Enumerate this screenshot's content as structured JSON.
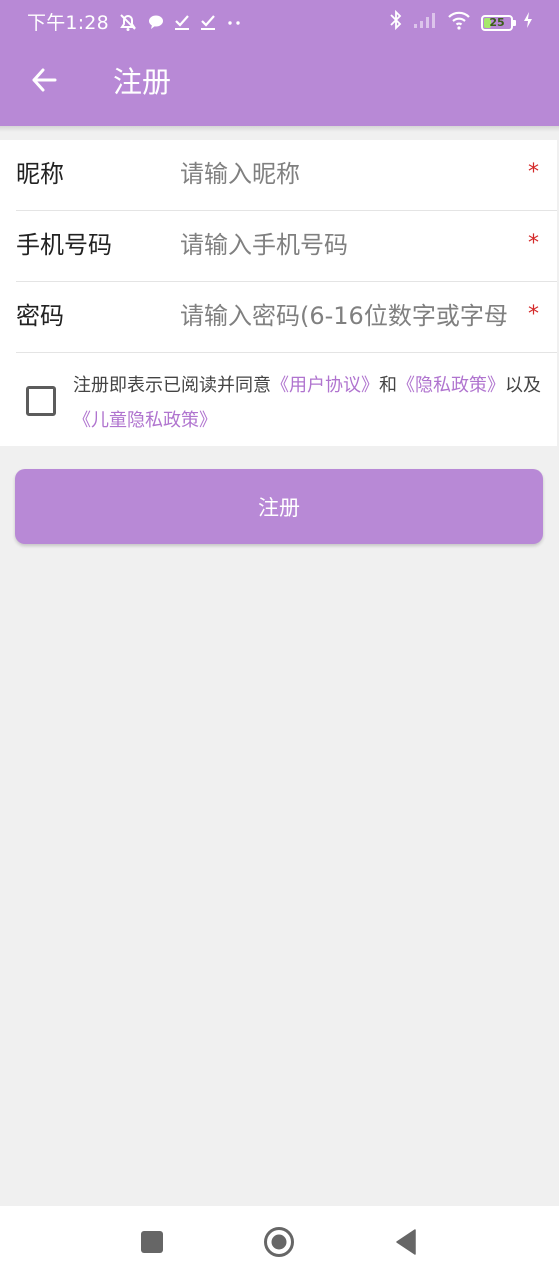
{
  "status_bar": {
    "time": "下午1:28",
    "battery_level": "25",
    "battery_fraction": 0.25,
    "left_icons": [
      "alarm-off-icon",
      "chat-bubble-icon",
      "check-icon",
      "check-icon",
      "more-dots-icon"
    ],
    "right_icons": [
      "bluetooth-icon",
      "signal-icon",
      "wifi-icon",
      "battery-icon",
      "charging-icon"
    ]
  },
  "header": {
    "title": "注册",
    "back_icon": "arrow-left-icon"
  },
  "form": {
    "nickname": {
      "label": "昵称",
      "placeholder": "请输入昵称",
      "value": "",
      "required_mark": "*"
    },
    "phone": {
      "label": "手机号码",
      "placeholder": "请输入手机号码",
      "value": "",
      "required_mark": "*"
    },
    "password": {
      "label": "密码",
      "placeholder": "请输入密码(6-16位数字或字母",
      "value": "",
      "required_mark": "*"
    }
  },
  "agreement": {
    "checked": false,
    "prefix": "注册即表示已阅读并同意",
    "user_agreement": "《用户协议》",
    "and": "和",
    "privacy_policy": "《隐私政策》",
    "also": "以及",
    "child_privacy_policy": "《儿童隐私政策》"
  },
  "register_button": {
    "label": "注册"
  },
  "nav_bar": {
    "icons": [
      "recents-square-icon",
      "home-circle-icon",
      "back-triangle-icon"
    ]
  },
  "colors": {
    "primary": "#b889d6",
    "link": "#b074cf",
    "required": "#d42a2a",
    "background": "#f0f0f0"
  }
}
